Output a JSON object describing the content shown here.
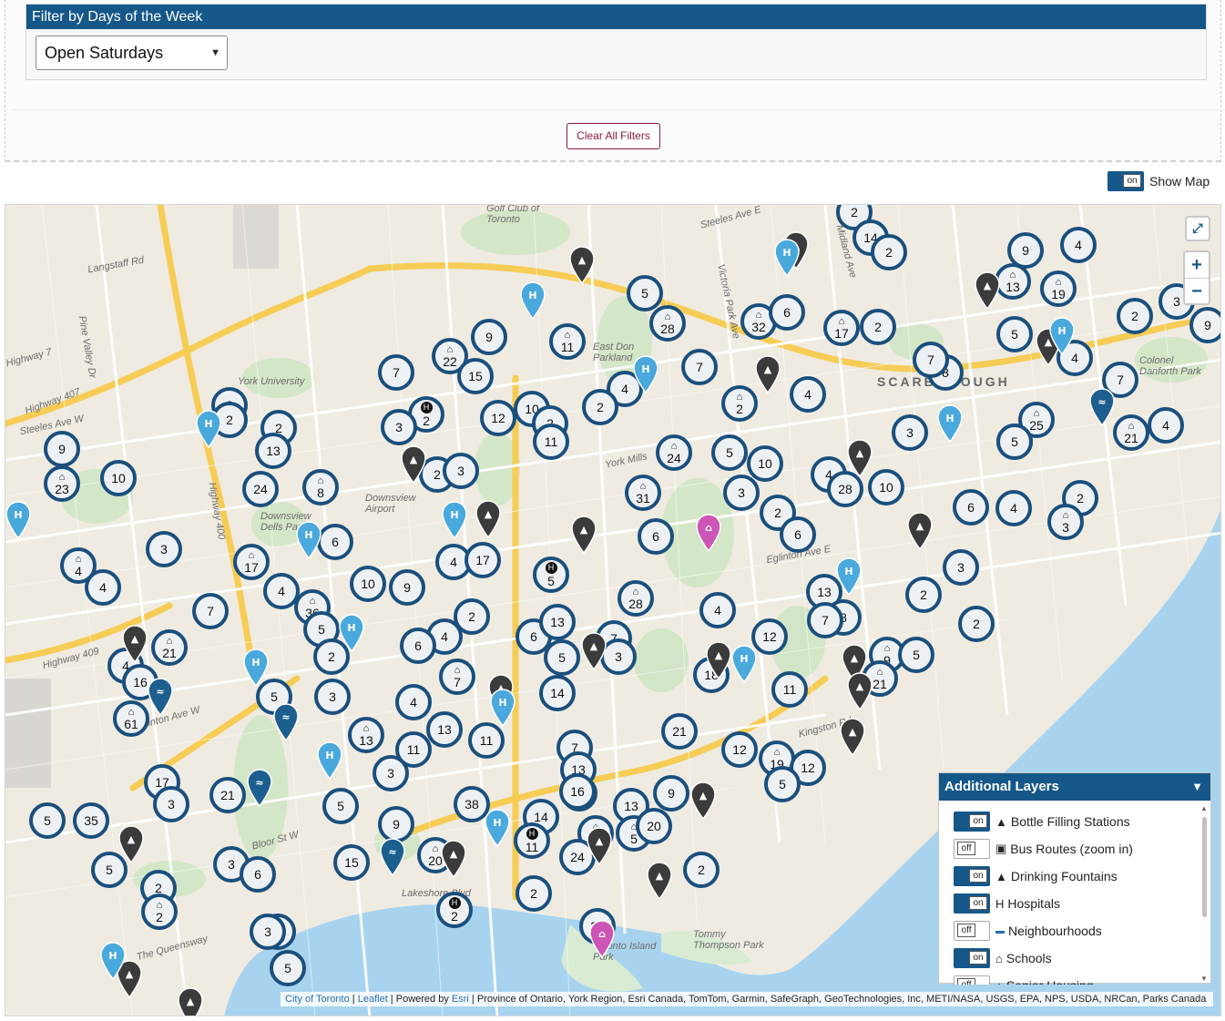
{
  "filter": {
    "title": "Filter by Days of the Week",
    "selected": "Open Saturdays",
    "clear_label": "Clear All Filters"
  },
  "show_map": {
    "toggle": "on",
    "label": "Show Map"
  },
  "map": {
    "zoom_in": "+",
    "zoom_out": "−",
    "labels": [
      {
        "text": "Langstaff Rd"
      },
      {
        "text": "Highway 7"
      },
      {
        "text": "Highway 407"
      },
      {
        "text": "York University"
      },
      {
        "text": "Steeles Ave W"
      },
      {
        "text": "Steeles Ave E"
      },
      {
        "text": "Downsview Airport"
      },
      {
        "text": "Downsview Dells Park"
      },
      {
        "text": "East Don Parkland"
      },
      {
        "text": "York Mills"
      },
      {
        "text": "SCARBOROUGH"
      },
      {
        "text": "Colonel Danforth Park"
      },
      {
        "text": "Eglinton Ave E"
      },
      {
        "text": "Eglinton Ave W"
      },
      {
        "text": "Highway 409"
      },
      {
        "text": "Highway 400"
      },
      {
        "text": "Bloor St W"
      },
      {
        "text": "The Queensway"
      },
      {
        "text": "Lakeshore Blvd"
      },
      {
        "text": "Tommy Thompson Park"
      },
      {
        "text": "Golf Club of Toronto"
      },
      {
        "text": "Victoria Park Ave"
      },
      {
        "text": "Midland Ave"
      },
      {
        "text": "Pine Valley Dr"
      },
      {
        "text": "Kingston Rd"
      },
      {
        "text": "Toronto Island Park"
      }
    ],
    "clusters": [
      {
        "n": "2"
      },
      {
        "n": "14"
      },
      {
        "n": "2"
      },
      {
        "n": "9"
      },
      {
        "n": "4"
      },
      {
        "n": "13",
        "icon": "school"
      },
      {
        "n": "19",
        "icon": "school"
      },
      {
        "n": "3"
      },
      {
        "n": "2"
      },
      {
        "n": "5"
      },
      {
        "n": "9"
      },
      {
        "n": "7"
      },
      {
        "n": "5"
      },
      {
        "n": "28",
        "icon": "school"
      },
      {
        "n": "32",
        "icon": "school"
      },
      {
        "n": "6"
      },
      {
        "n": "17",
        "icon": "school"
      },
      {
        "n": "2"
      },
      {
        "n": "5"
      },
      {
        "n": "4"
      },
      {
        "n": "9"
      },
      {
        "n": "11",
        "icon": "school"
      },
      {
        "n": "7"
      },
      {
        "n": "22",
        "icon": "school"
      },
      {
        "n": "15"
      },
      {
        "n": "7"
      },
      {
        "n": "8"
      },
      {
        "n": "7"
      },
      {
        "n": "4"
      },
      {
        "n": "2",
        "icon": "school"
      },
      {
        "n": "4"
      },
      {
        "n": "2"
      },
      {
        "n": "12"
      },
      {
        "n": "10"
      },
      {
        "n": "2"
      },
      {
        "n": "11"
      },
      {
        "n": "2",
        "icon": "hospital"
      },
      {
        "n": "3"
      },
      {
        "n": "25",
        "icon": "school"
      },
      {
        "n": "21",
        "icon": "school"
      },
      {
        "n": "4"
      },
      {
        "n": "3"
      },
      {
        "n": "5"
      },
      {
        "n": "24",
        "icon": "school"
      },
      {
        "n": "5"
      },
      {
        "n": "10"
      },
      {
        "n": "4"
      },
      {
        "n": "10"
      },
      {
        "n": "28"
      },
      {
        "n": "6"
      },
      {
        "n": "4"
      },
      {
        "n": "2"
      },
      {
        "n": "3",
        "icon": "school"
      },
      {
        "n": "2"
      },
      {
        "n": "2"
      },
      {
        "n": "2"
      },
      {
        "n": "13"
      },
      {
        "n": "9"
      },
      {
        "n": "23",
        "icon": "school"
      },
      {
        "n": "10"
      },
      {
        "n": "8",
        "icon": "school"
      },
      {
        "n": "24"
      },
      {
        "n": "2"
      },
      {
        "n": "3"
      },
      {
        "n": "31",
        "icon": "school"
      },
      {
        "n": "3"
      },
      {
        "n": "2"
      },
      {
        "n": "6"
      },
      {
        "n": "6"
      },
      {
        "n": "6"
      },
      {
        "n": "3"
      },
      {
        "n": "4",
        "icon": "school"
      },
      {
        "n": "4"
      },
      {
        "n": "17",
        "icon": "school"
      },
      {
        "n": "10"
      },
      {
        "n": "9"
      },
      {
        "n": "4"
      },
      {
        "n": "17"
      },
      {
        "n": "5",
        "icon": "hospital"
      },
      {
        "n": "28",
        "icon": "school"
      },
      {
        "n": "3"
      },
      {
        "n": "2"
      },
      {
        "n": "2"
      },
      {
        "n": "13"
      },
      {
        "n": "8"
      },
      {
        "n": "7"
      },
      {
        "n": "36",
        "icon": "school"
      },
      {
        "n": "4"
      },
      {
        "n": "2"
      },
      {
        "n": "4"
      },
      {
        "n": "5"
      },
      {
        "n": "21",
        "icon": "school"
      },
      {
        "n": "4"
      },
      {
        "n": "7"
      },
      {
        "n": "2"
      },
      {
        "n": "6"
      },
      {
        "n": "6"
      },
      {
        "n": "13"
      },
      {
        "n": "7"
      },
      {
        "n": "3"
      },
      {
        "n": "5"
      },
      {
        "n": "12"
      },
      {
        "n": "9",
        "icon": "school"
      },
      {
        "n": "5"
      },
      {
        "n": "4"
      },
      {
        "n": "16"
      },
      {
        "n": "5"
      },
      {
        "n": "3"
      },
      {
        "n": "4"
      },
      {
        "n": "7",
        "icon": "school"
      },
      {
        "n": "61",
        "icon": "school"
      },
      {
        "n": "14"
      },
      {
        "n": "18"
      },
      {
        "n": "11"
      },
      {
        "n": "21",
        "icon": "school"
      },
      {
        "n": "13",
        "icon": "school"
      },
      {
        "n": "13"
      },
      {
        "n": "11"
      },
      {
        "n": "11"
      },
      {
        "n": "21"
      },
      {
        "n": "30",
        "icon": "school"
      },
      {
        "n": "12"
      },
      {
        "n": "19",
        "icon": "school"
      },
      {
        "n": "12"
      },
      {
        "n": "5"
      },
      {
        "n": "7"
      },
      {
        "n": "13"
      },
      {
        "n": "3"
      },
      {
        "n": "17"
      },
      {
        "n": "3"
      },
      {
        "n": "21"
      },
      {
        "n": "16"
      },
      {
        "n": "9"
      },
      {
        "n": "5"
      },
      {
        "n": "5"
      },
      {
        "n": "35"
      },
      {
        "n": "38"
      },
      {
        "n": "13"
      },
      {
        "n": "9"
      },
      {
        "n": "14"
      },
      {
        "n": "5",
        "icon": "school"
      },
      {
        "n": "20"
      },
      {
        "n": "11",
        "icon": "hospital"
      },
      {
        "n": "26",
        "icon": "school"
      },
      {
        "n": "24"
      },
      {
        "n": "15"
      },
      {
        "n": "20",
        "icon": "school"
      },
      {
        "n": "5"
      },
      {
        "n": "2"
      },
      {
        "n": "3"
      },
      {
        "n": "6"
      },
      {
        "n": "2",
        "icon": "school"
      },
      {
        "n": "18",
        "icon": "school"
      },
      {
        "n": "2",
        "icon": "hospital"
      },
      {
        "n": "2"
      },
      {
        "n": "2"
      },
      {
        "n": "38"
      },
      {
        "n": "3"
      },
      {
        "n": "5"
      }
    ]
  },
  "layers": {
    "title": "Additional Layers",
    "items": [
      {
        "state": "on",
        "icon": "drop-icon",
        "glyph": "▲",
        "label": "Bottle Filling Stations"
      },
      {
        "state": "off",
        "icon": "bus-icon",
        "glyph": "▣",
        "label": "Bus Routes (zoom in)"
      },
      {
        "state": "on",
        "icon": "drop-icon",
        "glyph": "▲",
        "label": "Drinking Fountains"
      },
      {
        "state": "on",
        "icon": "hospital-icon",
        "glyph": "H",
        "label": "Hospitals"
      },
      {
        "state": "off",
        "icon": "line-icon",
        "glyph": "—",
        "label": "Neighbourhoods"
      },
      {
        "state": "on",
        "icon": "school-icon",
        "glyph": "⌂",
        "label": "Schools"
      },
      {
        "state": "off",
        "icon": "home-icon",
        "glyph": "⌂",
        "label": "Senior Housing"
      }
    ]
  },
  "attribution": {
    "link1": "City of Toronto",
    "link2": "Leaflet",
    "powered": "Powered by",
    "link3": "Esri",
    "rest": "Province of Ontario, York Region, Esri Canada, TomTom, Garmin, SafeGraph, GeoTechnologies, Inc, METI/NASA, USGS, EPA, NPS, USDA, NRCan, Parks Canada"
  },
  "colors": {
    "brand": "#16578a",
    "cluster_ring": "#1a4f7d",
    "pin_dark": "#3b3b3b",
    "pin_light": "#4aa9dc",
    "pin_pink": "#cc55b5",
    "water": "#a8d3ef"
  }
}
